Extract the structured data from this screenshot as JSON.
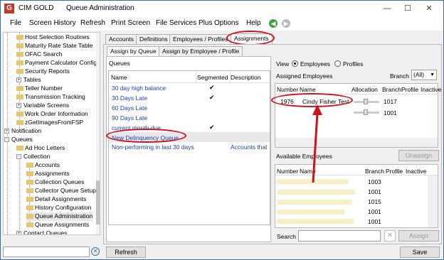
{
  "window": {
    "app_title": "CIM GOLD",
    "screen_title": "Queue Administration",
    "minimize_icon": "minimize-icon",
    "maximize_icon": "maximize-icon",
    "close_icon": "close-icon"
  },
  "menu": {
    "items": [
      "File",
      "Screen History",
      "Refresh",
      "Print Screen",
      "File Services Plus",
      "Options",
      "Help"
    ],
    "back_icon": "back-arrow-icon",
    "forward_icon": "forward-arrow-icon"
  },
  "tree": {
    "items": [
      {
        "label": "Host Selection Routines",
        "expander": ""
      },
      {
        "label": "Maturity Rate State Table",
        "expander": ""
      },
      {
        "label": "OFAC Search",
        "expander": ""
      },
      {
        "label": "Payment Calculator Config",
        "expander": ""
      },
      {
        "label": "Security Reports",
        "expander": ""
      },
      {
        "label": "Tables",
        "expander": "+"
      },
      {
        "label": "Teller Number",
        "expander": ""
      },
      {
        "label": "Transmission Tracking",
        "expander": ""
      },
      {
        "label": "Variable Screens",
        "expander": "+"
      },
      {
        "label": "Work Order Information",
        "expander": ""
      },
      {
        "label": "zGetImagesFromFSP",
        "expander": ""
      },
      {
        "label": "Notification",
        "expander": "+"
      },
      {
        "label": "Queues",
        "expander": "-"
      },
      {
        "label": "Ad Hoc Letters",
        "expander": ""
      },
      {
        "label": "Collection",
        "expander": "-"
      },
      {
        "label": "Accounts",
        "expander": ""
      },
      {
        "label": "Assignments",
        "expander": ""
      },
      {
        "label": "Collection Queues",
        "expander": ""
      },
      {
        "label": "Collector Queue Setup",
        "expander": ""
      },
      {
        "label": "Detail Assignments",
        "expander": ""
      },
      {
        "label": "History Configuration",
        "expander": ""
      },
      {
        "label": "Queue Administration",
        "expander": ""
      },
      {
        "label": "Queue Assignments",
        "expander": ""
      },
      {
        "label": "Contact Queues",
        "expander": "+"
      }
    ],
    "clear_icon": "clear-search-icon"
  },
  "tabs": [
    "Accounts",
    "Definitions",
    "Employees / Profiles",
    "Assignments"
  ],
  "subtabs": [
    "Assign by Queue",
    "Assign by Employee / Profile"
  ],
  "queues": {
    "heading": "Queues",
    "columns": [
      "Name",
      "Segmented",
      "Description"
    ],
    "rows": [
      {
        "name": "30 day high balance",
        "segmented": "✔",
        "description": ""
      },
      {
        "name": "30 Days Late",
        "segmented": "✔",
        "description": ""
      },
      {
        "name": "60 Days Late",
        "segmented": "",
        "description": ""
      },
      {
        "name": "90 Days Late",
        "segmented": "",
        "description": ""
      },
      {
        "name": "current month due",
        "segmented": "✔",
        "description": ""
      },
      {
        "name": "New Delinquency Queue",
        "segmented": "",
        "description": ""
      },
      {
        "name": "Non-performing in last 30 days",
        "segmented": "",
        "description": "Accounts that"
      }
    ]
  },
  "view": {
    "label": "View",
    "employees": "Employees",
    "profiles": "Profiles",
    "selected": "Employees"
  },
  "assigned": {
    "heading": "Assigned Employees",
    "branch_label": "Branch",
    "branch_value": "(All)",
    "columns": [
      "Number",
      "Name",
      "Allocation",
      "Branch",
      "Profile",
      "Inactive"
    ],
    "rows": [
      {
        "number": "1976",
        "name": "Cindy Fisher Test",
        "branch": "1017"
      },
      {
        "number": "",
        "name": "",
        "branch": "1001"
      }
    ]
  },
  "available": {
    "heading": "Available Employees",
    "unassign": "Unassign",
    "columns": [
      "Number",
      "Name",
      "Branch",
      "Profile",
      "Inactive"
    ],
    "rows": [
      {
        "branch": "1003"
      },
      {
        "branch": "1001"
      },
      {
        "branch": "1015"
      },
      {
        "branch": "1001"
      },
      {
        "branch": "1001"
      }
    ]
  },
  "search": {
    "label": "Search",
    "value": "",
    "assign": "Assign"
  },
  "footer": {
    "refresh": "Refresh",
    "save": "Save"
  },
  "colors": {
    "annotation_red": "#d0101a",
    "link_blue": "#1a3fb0",
    "selection_gray": "#e8e8e8"
  }
}
